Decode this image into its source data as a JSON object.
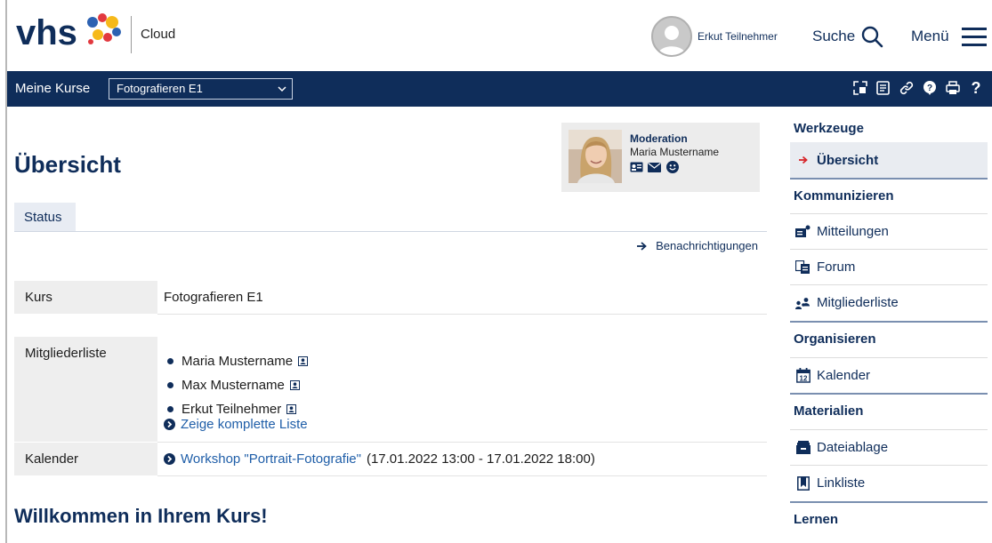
{
  "header": {
    "logo_text": "vhs",
    "cloud_label": "Cloud",
    "user_name": "Erkut Teilnehmer",
    "search_label": "Suche",
    "menu_label": "Menü"
  },
  "navbar": {
    "my_courses_label": "Meine Kurse",
    "course_select_value": "Fotografieren E1",
    "icons": [
      "resize-icon",
      "notes-icon",
      "link-icon",
      "info-icon",
      "print-icon",
      "help-icon"
    ]
  },
  "main": {
    "title": "Übersicht",
    "moderation": {
      "heading": "Moderation",
      "name": "Maria Mustername",
      "icons": [
        "vcard-icon",
        "mail-icon",
        "smile-icon"
      ]
    },
    "tab_status": "Status",
    "notifications_link": "Benachrichtigungen",
    "kurs": {
      "label": "Kurs",
      "value": "Fotografieren E1"
    },
    "members": {
      "label": "Mitgliederliste",
      "items": [
        "Maria Mustername",
        "Max Mustername",
        "Erkut Teilnehmer"
      ],
      "full_list_link": "Zeige komplette Liste"
    },
    "calendar": {
      "label": "Kalender",
      "event_link": "Workshop \"Portrait-Fotografie\"",
      "event_time": "(17.01.2022 13:00 - 17.01.2022 18:00)"
    },
    "welcome": "Willkommen in Ihrem Kurs!"
  },
  "tools": {
    "sections": [
      {
        "heading": "Werkzeuge",
        "items": [
          "Übersicht"
        ]
      },
      {
        "heading": "Kommunizieren",
        "items": [
          "Mitteilungen",
          "Forum",
          "Mitgliederliste"
        ]
      },
      {
        "heading": "Organisieren",
        "items": [
          "Kalender"
        ]
      },
      {
        "heading": "Materialien",
        "items": [
          "Dateiablage",
          "Linkliste"
        ]
      },
      {
        "heading": "Lernen",
        "items": []
      }
    ],
    "active_item": "Übersicht"
  },
  "colors": {
    "brand_navy": "#0f2d5a",
    "link_blue": "#1f5ea8",
    "active_arrow": "#d7262b",
    "logo_yellow": "#f6b91a",
    "logo_red": "#e2393f",
    "logo_blue": "#2d62b2"
  }
}
